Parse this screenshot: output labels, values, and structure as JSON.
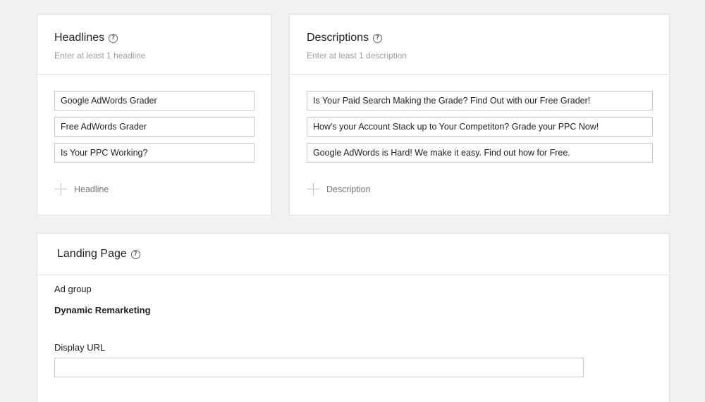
{
  "headlines": {
    "title": "Headlines",
    "subtitle": "Enter at least 1 headline",
    "fields": [
      "Google AdWords Grader",
      "Free AdWords Grader",
      "Is Your PPC Working?"
    ],
    "add_label": "Headline"
  },
  "descriptions": {
    "title": "Descriptions",
    "subtitle": "Enter at least 1 description",
    "fields": [
      "Is Your Paid Search Making the Grade? Find Out with our Free Grader!",
      "How's your Account Stack up to Your Competiton? Grade your PPC Now!",
      "Google AdWords is Hard! We make it easy. Find out how for Free."
    ],
    "add_label": "Description"
  },
  "landing_page": {
    "title": "Landing Page",
    "ad_group_label": "Ad group",
    "ad_group_value": "Dynamic Remarketing",
    "display_url_label": "Display URL",
    "display_url_value": ""
  },
  "icons": {
    "help": "help-circle-icon",
    "add": "plus-icon"
  }
}
